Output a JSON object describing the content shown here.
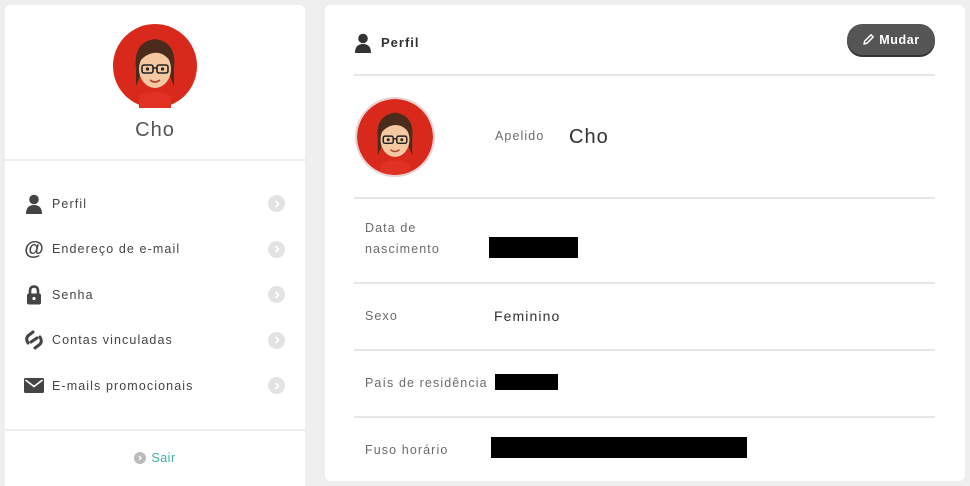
{
  "sidebar": {
    "user_name": "Cho",
    "nav": [
      {
        "label": "Perfil",
        "icon": "person-icon"
      },
      {
        "label": "Endereço de e-mail",
        "icon": "at-icon"
      },
      {
        "label": "Senha",
        "icon": "lock-icon"
      },
      {
        "label": "Contas vinculadas",
        "icon": "link-icon"
      },
      {
        "label": "E-mails promocionais",
        "icon": "envelope-icon"
      }
    ],
    "logout_label": "Sair"
  },
  "main": {
    "title": "Perfil",
    "edit_label": "Mudar",
    "fields": {
      "nickname": {
        "label": "Apelido",
        "value": "Cho"
      },
      "birthdate": {
        "label": "Data de\nnascimento",
        "value": ""
      },
      "gender": {
        "label": "Sexo",
        "value": "Feminino"
      },
      "country": {
        "label": "País de residência",
        "value": ""
      },
      "timezone": {
        "label": "Fuso horário",
        "value": ""
      }
    }
  },
  "colors": {
    "accent_link": "#3bb1a8",
    "avatar_bg": "#d9291c",
    "button_bg": "#555555"
  }
}
